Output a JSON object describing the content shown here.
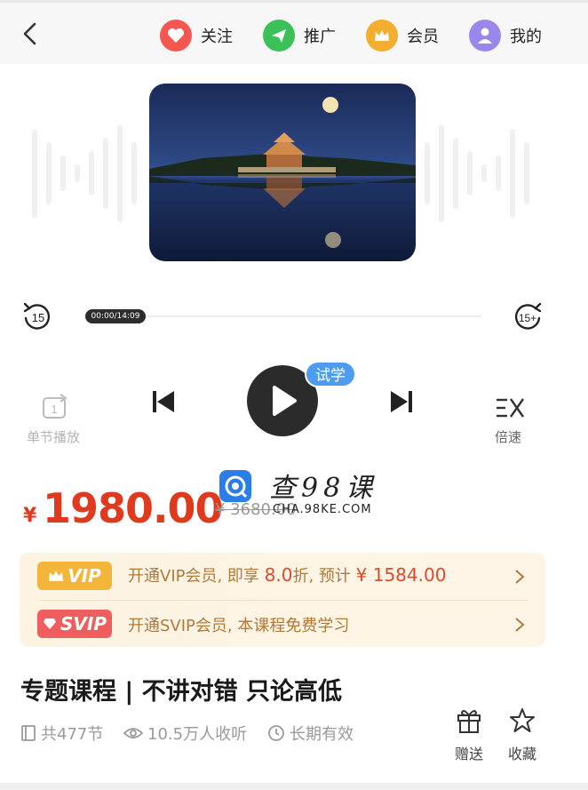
{
  "header": {
    "nav": [
      {
        "label": "关注",
        "icon": "heart-icon",
        "color": "#f2584f"
      },
      {
        "label": "推广",
        "icon": "paper-plane-icon",
        "color": "#3cc158"
      },
      {
        "label": "会员",
        "icon": "crown-icon",
        "color": "#f3ad2f"
      },
      {
        "label": "我的",
        "icon": "user-icon",
        "color": "#9b87ec"
      }
    ]
  },
  "player": {
    "current_time": "00:00/14:09",
    "progress": 0,
    "rewind_label": "15",
    "forward_label": "15+",
    "trial_badge": "试学",
    "single_play_label": "单节播放",
    "speed_label": "倍速"
  },
  "price": {
    "currency": "¥",
    "current": "1980.00",
    "original": "¥ 3680.00"
  },
  "watermark": {
    "text": "查98课",
    "url": "CHA.98KE.COM"
  },
  "vip": {
    "vip_badge": "VIP",
    "vip_text_prefix": "开通VIP会员, 即享 ",
    "vip_discount": "8.0",
    "vip_text_mid": "折, 预计 ",
    "vip_price": "¥ 1584.00",
    "svip_badge": "SVIP",
    "svip_text": "开通SVIP会员, 本课程免费学习"
  },
  "course": {
    "title": "专题课程 | 不讲对错 只论高低",
    "lessons": "共477节",
    "listeners": "10.5万人收听",
    "validity": "长期有效",
    "gift_label": "赠送",
    "favorite_label": "收藏"
  },
  "colors": {
    "accent_red": "#e03a1e",
    "trial_blue": "#4d9cf0",
    "vip_gold": "#f4b63a",
    "svip_red": "#ee5e5e"
  }
}
